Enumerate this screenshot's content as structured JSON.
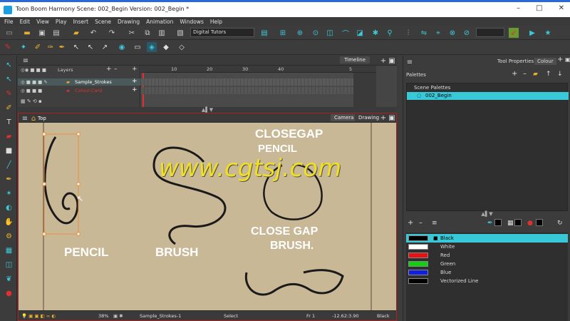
{
  "window": {
    "title": "Toon Boom Harmony Scene: 002_Begin Version: 002_Begin *",
    "controls": [
      "–",
      "□",
      "✕"
    ]
  },
  "menu": [
    "File",
    "Edit",
    "View",
    "Play",
    "Insert",
    "Scene",
    "Drawing",
    "Animation",
    "Windows",
    "Help"
  ],
  "toolbar": {
    "workspace": "Digital Tutors"
  },
  "timeline": {
    "tab": "Timeline",
    "layers_label": "Layers",
    "layers": [
      {
        "name": "Sample_Strokes",
        "selected": true
      },
      {
        "name": "Colour-Card",
        "selected": false
      }
    ],
    "ruler": [
      "10",
      "20",
      "30",
      "40",
      "5"
    ]
  },
  "camera": {
    "breadcrumb": "Top",
    "tabs": [
      "Camera",
      "Drawing"
    ],
    "labels": {
      "closegap_pencil_1": "CLOSEGAP",
      "closegap_pencil_2": "PENCIL",
      "closegap_brush_1": "CLOSE GAP",
      "closegap_brush_2": "BRUSH.",
      "pencil": "PENCIL",
      "brush": "BRUSH"
    },
    "watermark": "www.cgtsj.com",
    "status": {
      "zoom": "38%",
      "layer": "Sample_Strokes-1",
      "mode": "Select",
      "frame": "Fr 1",
      "coords": "-12.62:3.90",
      "color": "Black"
    }
  },
  "right": {
    "tabs": [
      "Tool Properties",
      "Colour"
    ],
    "palettes_label": "Palettes",
    "scene_palettes": "Scene Palettes",
    "palettes": [
      "002_Begin"
    ],
    "colors": [
      {
        "name": "Black",
        "hex": "#000000"
      },
      {
        "name": "White",
        "hex": "#ffffff"
      },
      {
        "name": "Red",
        "hex": "#e81010"
      },
      {
        "name": "Green",
        "hex": "#10d010"
      },
      {
        "name": "Blue",
        "hex": "#1020e0"
      },
      {
        "name": "Vectorized Line",
        "hex": "#000000"
      }
    ]
  }
}
